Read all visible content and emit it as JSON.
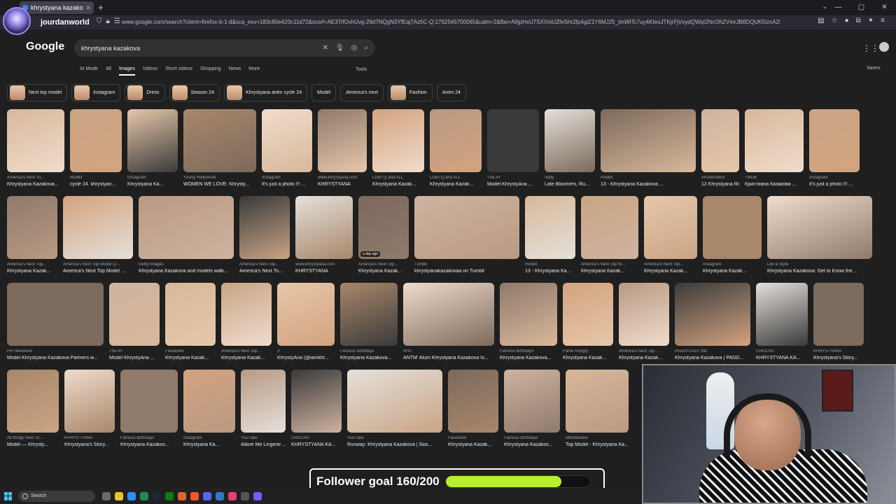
{
  "browser": {
    "tab_title": "khrystyana kazakova - Google S",
    "url": "www.google.com/search?client=firefox-b-1-d&sca_esv=183c80e420c11d72&sxsrf=AE3TifOxhUvg-29d7NQgN3YfEaj7Az5C-Q:1762545700065&udm=2&fbs=AIIjpHxU7SXXniUZfeShr2fp4giZ1Y6MJ25_tmWITc7uy4KIeoJTKjrFjVxydQWqI2NcOhZVmrJB8DQUK5IzxA2fZbQFrCfZ7DsBw9Vv9QKv56j2AP7ANhp9ddfU..."
  },
  "streamer": {
    "name": "jourdanworld"
  },
  "google": {
    "logo": "Google",
    "query": "khrystyana kazakova",
    "tabs": [
      "AI Mode",
      "All",
      "Images",
      "Videos",
      "Short videos",
      "Shopping",
      "News",
      "More"
    ],
    "active_tab": "Images",
    "tools": "Tools",
    "saves": "Saves"
  },
  "chips": [
    "Next top model",
    "Instagram",
    "Dress",
    "Season 24",
    "Khrystyana antm cycle 24",
    "Model",
    "America's next",
    "Fashion",
    "Antm 24"
  ],
  "results": [
    [
      {
        "src": "America's Next To...",
        "title": "Khrystyana Kazakova..."
      },
      {
        "src": "Reddit",
        "title": "cycle 24. khrystyan..."
      },
      {
        "src": "Instagram",
        "title": "Khrystyana Ka..."
      },
      {
        "src": "Young Hollywood",
        "title": "WOMEN WE LOVE: Khrysty..."
      },
      {
        "src": "Instagram",
        "title": "It's just a photo !!! ..."
      },
      {
        "src": "www.khrystyana.com",
        "title": "KHRYSTYANA"
      },
      {
        "src": "LGBTQ and ALL",
        "title": "Khrystyana Kazak..."
      },
      {
        "src": "LGBTQ and ALL",
        "title": "Khrystyana Kazak..."
      },
      {
        "src": "The AY",
        "title": "Model KhrystyAna ..."
      },
      {
        "src": "Salty",
        "title": "Late Bloomers, Ru..."
      },
      {
        "src": "Reddit",
        "title": "13 - Khrystyana Kazakova ..."
      },
      {
        "src": "Shutterstock",
        "title": "12 Khrystyana Roy..."
      },
      {
        "src": "TMDB",
        "title": "Кристиана Казакова ..."
      },
      {
        "src": "Instagram",
        "title": "It's just a photo !!! ..."
      }
    ],
    [
      {
        "src": "America's Next Top...",
        "title": "Khrystyana Kazak..."
      },
      {
        "src": "America's Next Top Model (2...",
        "title": "America's Next Top Model ..."
      },
      {
        "src": "Getty Images",
        "title": "Khrystyana Kazakova and models walk..."
      },
      {
        "src": "America's Next Top...",
        "title": "America's Next To..."
      },
      {
        "src": "www.khrystyana.com",
        "title": "KHRYSTYANA"
      },
      {
        "src": "America's Next Top...",
        "title": "Khrystyana Kazak...",
        "tag": "a day ago"
      },
      {
        "src": "Tumblr",
        "title": "khrystyanakazakovaa on Tumblr"
      },
      {
        "src": "Reddit",
        "title": "13 - Khrystyana Ka..."
      },
      {
        "src": "America's Next Top M...",
        "title": "Khrystyana Kazak..."
      },
      {
        "src": "America's Next Top...",
        "title": "Khrystyana Kazak..."
      },
      {
        "src": "Instagram",
        "title": "Khrystyana Kazak..."
      },
      {
        "src": "Life & Style",
        "title": "Khrystyana Kazakova: Get to Know the ..."
      }
    ],
    [
      {
        "src": "PR Newswire",
        "title": "Model Khrystyana Kazakova Partners w..."
      },
      {
        "src": "The AY",
        "title": "Model KhrystyAna ..."
      },
      {
        "src": "Facebook",
        "title": "Khrystyana Kazak..."
      },
      {
        "src": "America's Next Top...",
        "title": "Khrystyana Kazak..."
      },
      {
        "src": "X",
        "title": "KhrystyAna (@iamkhr..."
      },
      {
        "src": "Famous Birthdays",
        "title": "Khrystyana Kazakova..."
      },
      {
        "src": "VH1",
        "title": "ANTM' Alum Khrystyana Kazakova Is..."
      },
      {
        "src": "Famous Birthdays",
        "title": "Khrystyana Kazakova..."
      },
      {
        "src": "Fame Hungry",
        "title": "Khrystyana Kazak..."
      },
      {
        "src": "America's Next Top...",
        "title": "Khrystyana Kazak..."
      },
      {
        "src": "PADDYLAST INC",
        "title": "Khrystyana Kazakova | PADD..."
      },
      {
        "src": "CHUCHU",
        "title": "KHRYSTYANA KA..."
      },
      {
        "src": "KHRYSTYANA",
        "title": "Khrystyana's Story..."
      }
    ],
    [
      {
        "src": "All things Next To...",
        "title": "Model — Khrysty..."
      },
      {
        "src": "KHRYSTYANA",
        "title": "Khrystyana's Story..."
      },
      {
        "src": "Famous Birthdays",
        "title": "Khrystyana Kazakov..."
      },
      {
        "src": "Instagram",
        "title": "Khrystyana Ka..."
      },
      {
        "src": "YouTube",
        "title": "Adore Me Lingerie ..."
      },
      {
        "src": "CHUCHU",
        "title": "KHRYSTYANA KA..."
      },
      {
        "src": "YouTube",
        "title": "Runway: Khrystyana Kazakova | Sea..."
      },
      {
        "src": "Facebook",
        "title": "Khrystyana Kazak..."
      },
      {
        "src": "Famous Birthdays",
        "title": "Khrystyana Kazakov..."
      },
      {
        "src": "MBoModels",
        "title": "Top Model - Khrystyana Ka..."
      }
    ]
  ],
  "overlay": {
    "follower_label": "Follower goal 160/200",
    "progress": 0.8
  },
  "taskbar": {
    "search_placeholder": "Search"
  }
}
